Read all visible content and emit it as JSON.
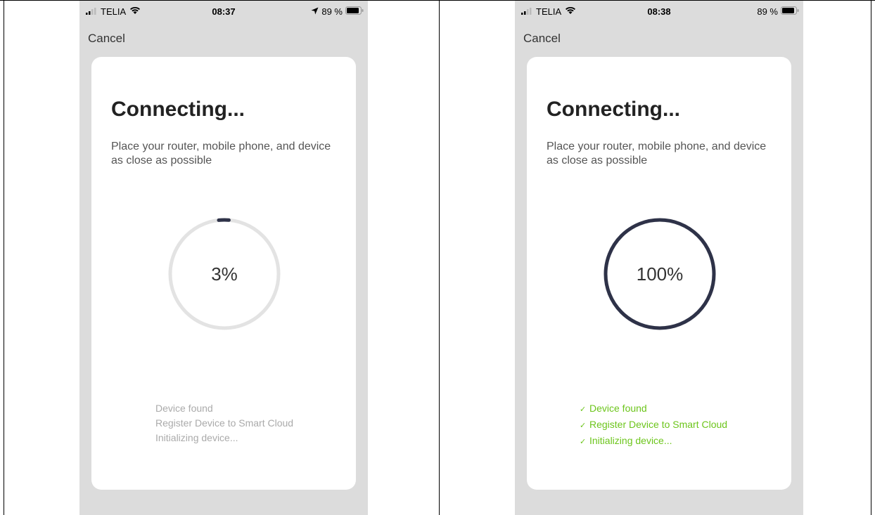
{
  "colors": {
    "background": "#dcdcdc",
    "card": "#ffffff",
    "ring_track": "#e3e3e3",
    "ring_progress": "#2e3248",
    "step_pending": "#aaaaaa",
    "step_done": "#6cc51b"
  },
  "screens": [
    {
      "status": {
        "carrier": "TELIA",
        "time": "08:37",
        "battery": "89 %",
        "location_icon": "location-arrow-icon"
      },
      "cancel_label": "Cancel",
      "title": "Connecting...",
      "description": "Place your router, mobile phone, and device as close as possible",
      "progress_fraction": 0.03,
      "progress_label": "3%",
      "steps": [
        {
          "label": "Device found",
          "done": false
        },
        {
          "label": "Register Device to Smart Cloud",
          "done": false
        },
        {
          "label": "Initializing device...",
          "done": false
        }
      ]
    },
    {
      "status": {
        "carrier": "TELIA",
        "time": "08:38",
        "battery": "89 %"
      },
      "cancel_label": "Cancel",
      "title": "Connecting...",
      "description": "Place your router, mobile phone, and device as close as possible",
      "progress_fraction": 1.0,
      "progress_label": "100%",
      "steps": [
        {
          "label": "Device found",
          "done": true
        },
        {
          "label": "Register Device to Smart Cloud",
          "done": true
        },
        {
          "label": "Initializing device...",
          "done": true
        }
      ]
    }
  ]
}
